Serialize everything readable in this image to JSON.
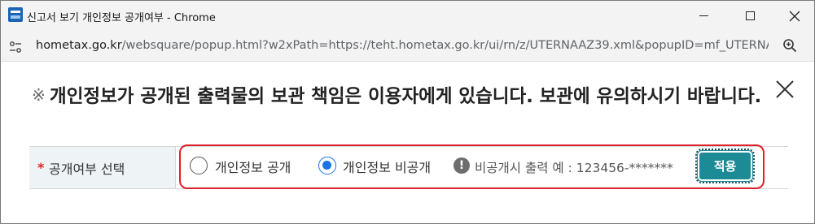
{
  "window": {
    "title": "신고서 보기 개인정보 공개여부 - Chrome"
  },
  "address_bar": {
    "url_host": "hometax.go.kr",
    "url_rest": "/websquare/popup.html?w2xPath=https://teht.hometax.go.kr/ui/rn/z/UTERNAAZ39.xml&popupID=mf_UTERNAA..."
  },
  "notice": {
    "mark": "※",
    "text": "개인정보가 공개된 출력물의 보관 책임은 이용자에게 있습니다. 보관에 유의하시기 바랍니다."
  },
  "form": {
    "required_mark": "*",
    "label": "공개여부 선택",
    "options": [
      {
        "label": "개인정보 공개",
        "checked": false
      },
      {
        "label": "개인정보 비공개",
        "checked": true
      }
    ],
    "info_glyph": "!",
    "hint": "비공개시 출력 예 : 123456-*******",
    "apply_label": "적용"
  },
  "colors": {
    "accent": "#1a73e8",
    "apply_button": "#1c8b96",
    "highlight_border": "#e0202a",
    "required": "#e02424"
  }
}
